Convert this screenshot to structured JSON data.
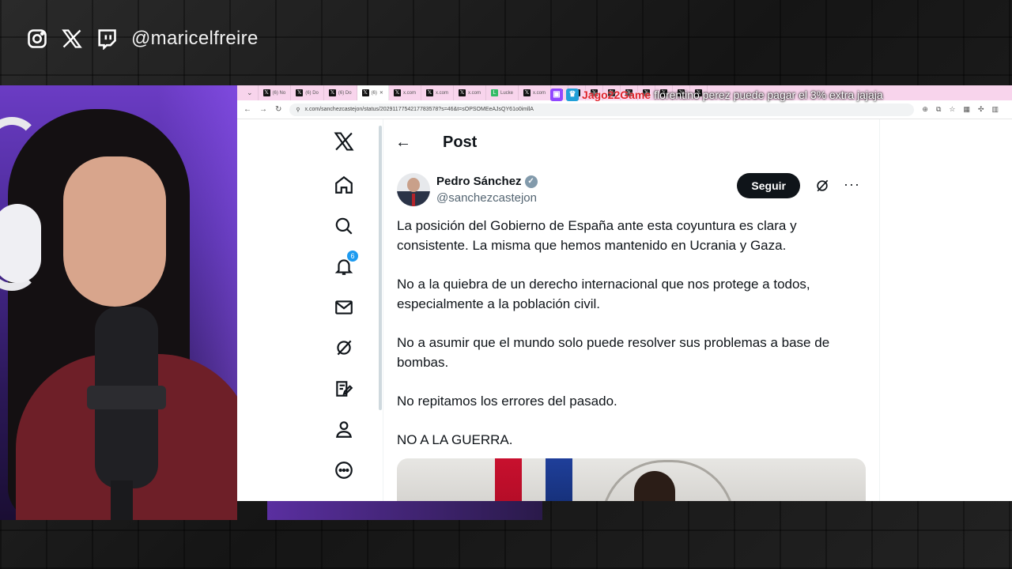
{
  "overlay": {
    "handle": "@maricelfreire",
    "social_icons": [
      "instagram-icon",
      "x-icon",
      "twitch-icon"
    ]
  },
  "browser": {
    "tabs": [
      {
        "label": "(6) No"
      },
      {
        "label": "(6) Do"
      },
      {
        "label": "(6) Do"
      },
      {
        "label": "(6)",
        "active": true
      },
      {
        "label": "x.com"
      },
      {
        "label": "x.com"
      },
      {
        "label": "x.com"
      },
      {
        "label": "Lucke"
      },
      {
        "label": "x.com"
      }
    ],
    "url": "x.com/sanchezcastejon/status/2029117754217783578?s=46&t=sOPSOMEeAJsQY61o0imllA",
    "chat_overlay": {
      "username": "Jago22Game",
      "message": "florentino perez puede pagar el 3% extra jajaja"
    }
  },
  "x": {
    "nav": {
      "notifications_badge": "6",
      "items": [
        "x-logo-icon",
        "home-icon",
        "search-icon",
        "notifications-icon",
        "messages-icon",
        "grok-icon",
        "premium-icon",
        "profile-icon",
        "more-icon"
      ]
    },
    "header": {
      "title": "Post"
    },
    "post": {
      "author_name": "Pedro Sánchez",
      "author_handle": "@sanchezcastejon",
      "follow_label": "Seguir",
      "paragraphs": [
        "La posición del Gobierno de España ante esta coyuntura es clara y consistente. La misma que hemos mantenido en Ucrania y Gaza.",
        "No a la quiebra de un derecho internacional que nos protege a todos, especialmente a la población civil.",
        "No a asumir que el mundo solo puede resolver sus problemas a base de bombas.",
        "No repitamos los errores del pasado.",
        "NO A LA GUERRA."
      ]
    }
  },
  "colors": {
    "x_text": "#0f1419",
    "x_secondary": "#536471",
    "x_blue": "#1d9bf0",
    "tab_bar": "#f8d4ec",
    "chat_username": "#e0242c"
  }
}
